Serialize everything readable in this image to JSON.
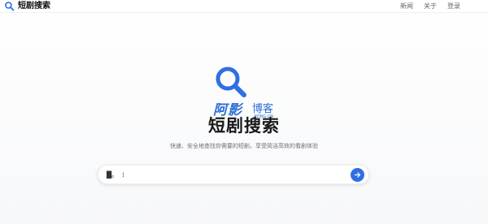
{
  "header": {
    "brand": "短剧搜索",
    "nav": [
      "新闻",
      "关于",
      "登录"
    ]
  },
  "hero": {
    "title": "短剧搜索",
    "subtitle": "快速、安全地查找你需要的短剧，享受简洁高效的看剧体验",
    "watermark_main": "阿影",
    "watermark_side": "博客",
    "watermark_small": "AYING.CN"
  },
  "search": {
    "value": "█。  ⁞",
    "placeholder": ""
  },
  "icons": {
    "brand": "search-icon",
    "hero": "search-icon",
    "submit": "arrow-right-icon"
  },
  "colors": {
    "accent": "#2f6fe4",
    "watermark": "#2e6fd8"
  }
}
